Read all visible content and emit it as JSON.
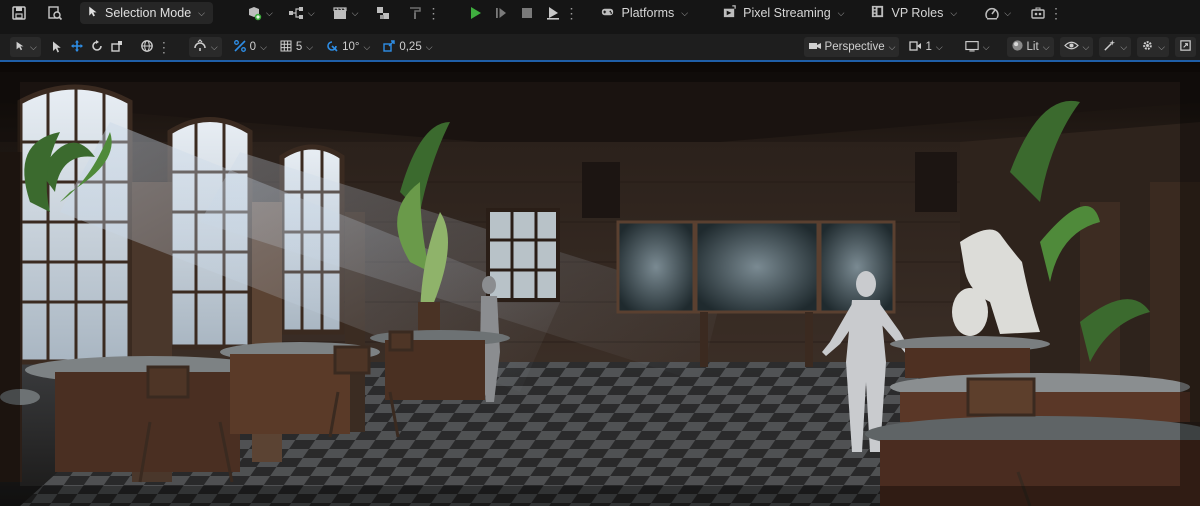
{
  "toolbar": {
    "mode_label": "Selection Mode",
    "platforms_label": "Platforms",
    "pixel_streaming_label": "Pixel Streaming",
    "vp_roles_label": "VP Roles"
  },
  "viewport_toolbar": {
    "rotate_snap_value": "0",
    "grid_snap_value": "5",
    "angle_snap_value": "10°",
    "scale_snap_value": "0,25",
    "view_mode_label": "Perspective",
    "camera_speed_value": "1",
    "lighting_label": "Lit"
  },
  "icons": {
    "save": "save-icon",
    "browse": "content-browser-icon",
    "mode": "select-arrow-icon",
    "add": "add-actor-icon",
    "blueprint": "blueprint-icon",
    "cinematics": "clapper-icon",
    "platforms": "gamepad-icon",
    "pixel_streaming": "streaming-icon",
    "vp_roles": "film-roles-icon"
  },
  "colors": {
    "play_green": "#3fae3f",
    "accent_blue": "#2e8ee6"
  }
}
